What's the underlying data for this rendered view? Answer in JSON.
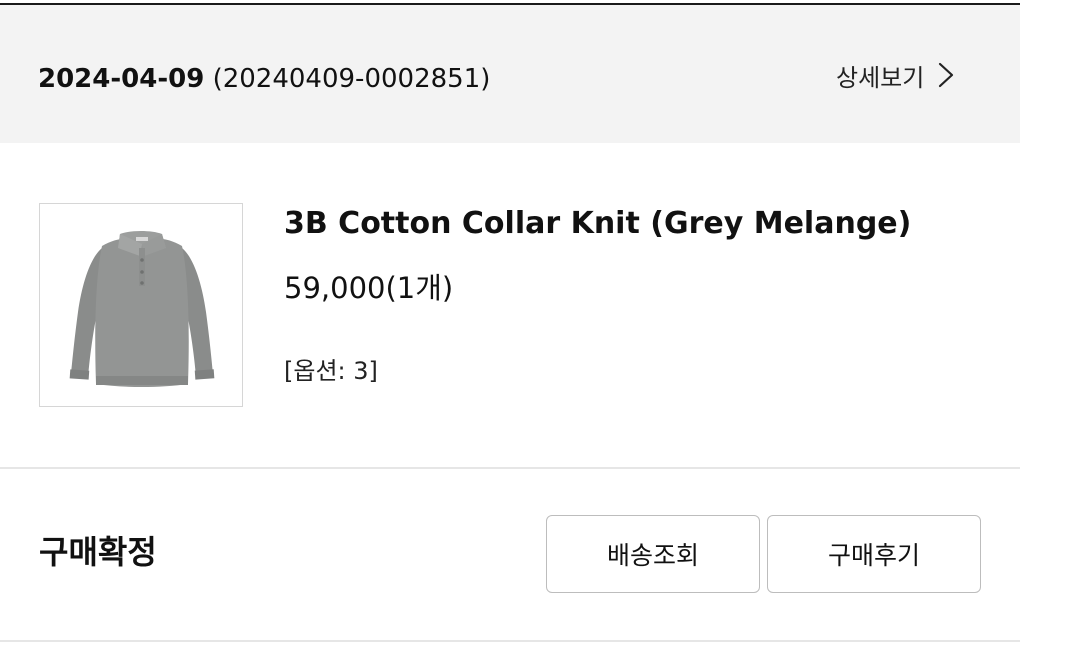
{
  "order": {
    "date": "2024-04-09",
    "number": "(20240409-0002851)",
    "detail_label": "상세보기"
  },
  "product": {
    "name": "3B Cotton Collar Knit (Grey Melange)",
    "price": "59,000(1개)",
    "option": "[옵션: 3]",
    "image_icon": "grey-polo-knit-sweater"
  },
  "status": {
    "label": "구매확정"
  },
  "actions": {
    "tracking_label": "배송조회",
    "review_label": "구매후기"
  },
  "colors": {
    "header_background": "#f3f3f3",
    "text": "#111111",
    "button_border": "#bdbdbd",
    "sweater_grey": "#8f9190"
  }
}
